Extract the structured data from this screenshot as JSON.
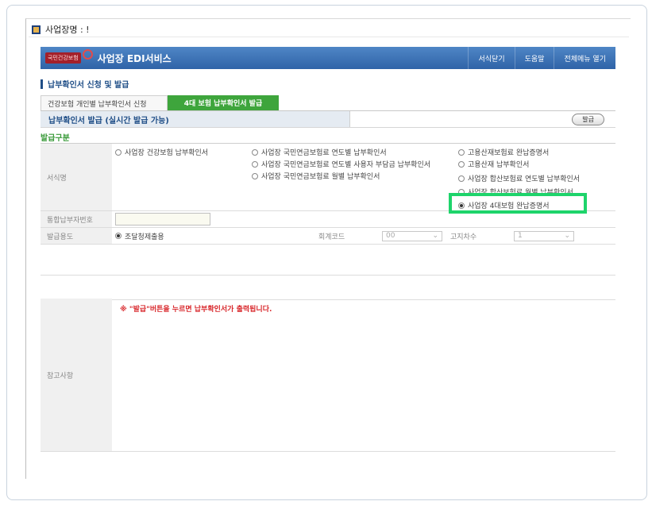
{
  "window": {
    "title": "사업장명 : !"
  },
  "header": {
    "logo_text": "국민건강보험",
    "title": "사업장 EDI서비스",
    "menu": [
      "서식닫기",
      "도움말",
      "전체메뉴 열기"
    ]
  },
  "section": {
    "title": "납부확인서 신청 및 발급"
  },
  "tabs": [
    {
      "label": "건강보험 개인별 납부확인서 신청"
    },
    {
      "label": "4대 보험 납부확인서 발급"
    }
  ],
  "subbar": {
    "title": "납부확인서 발급 (실시간 발급 가능)",
    "issue_button": "발급"
  },
  "group_label": "발급구분",
  "form_name": {
    "label": "서식명",
    "options": [
      {
        "label": "사업장 건강보험 납부확인서",
        "selected": false
      },
      {
        "label": "사업장 국민연금보험료 연도별 납부확인서",
        "selected": false
      },
      {
        "label": "사업장 국민연금보험료 연도별 사용자 부담금 납부확인서",
        "selected": false
      },
      {
        "label": "사업장 국민연금보험료 월별 납부확인서",
        "selected": false
      },
      {
        "label": "고용산재보험료 완납증명서",
        "selected": false
      },
      {
        "label": "고용산재 납부확인서",
        "selected": false
      },
      {
        "label": "사업장 합산보험료 연도별 납부확인서",
        "selected": false
      },
      {
        "label": "사업장 합산보험료 월별 납부확인서",
        "selected": false
      },
      {
        "label": "사업장 4대보험 완납증명서",
        "selected": true
      }
    ]
  },
  "payer_number": {
    "label": "통합납부자번호",
    "value": ""
  },
  "purpose": {
    "label": "발급용도",
    "option": "조달청제출용",
    "account_code_label": "회계코드",
    "account_code_value": "00",
    "notice_label": "고지차수",
    "notice_value": "1"
  },
  "notes": {
    "label": "참고사항",
    "text": "※ \"발급\"버튼을 누르면 납부확인서가 출력됩니다."
  },
  "colors": {
    "highlight": "#1ed46b",
    "header": "#3a70b5",
    "active_tab": "#3ea53c",
    "note_text": "#d8262a"
  }
}
